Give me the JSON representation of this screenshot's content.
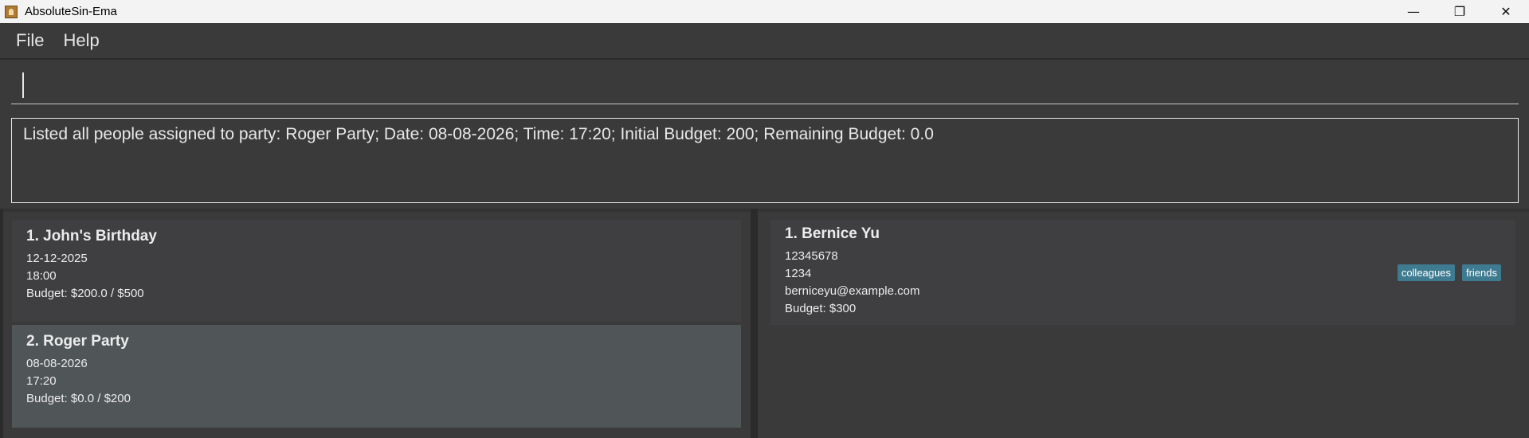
{
  "window": {
    "title": "AbsoluteSin-Ema",
    "controls": {
      "minimize": "—",
      "restore": "❐",
      "close": "✕"
    }
  },
  "menu": {
    "items": [
      "File",
      "Help"
    ]
  },
  "command": {
    "value": ""
  },
  "result": {
    "text": "Listed all people assigned to party: Roger Party; Date: 08-08-2026; Time: 17:20; Initial Budget: 200; Remaining Budget: 0.0"
  },
  "parties": [
    {
      "title": "1. John's Birthday",
      "date": "12-12-2025",
      "time": "18:00",
      "budget": "Budget: $200.0 / $500",
      "selected": false
    },
    {
      "title": "2. Roger Party",
      "date": "08-08-2026",
      "time": "17:20",
      "budget": "Budget: $0.0 / $200",
      "selected": true
    }
  ],
  "persons": [
    {
      "title": "1. Bernice Yu",
      "phone": "12345678",
      "address": "1234",
      "email": "berniceyu@example.com",
      "budget": "Budget: $300",
      "tags": [
        "colleagues",
        "friends"
      ]
    }
  ],
  "colors": {
    "background": "#3a3a3b",
    "card": "#3f3f42",
    "card_selected": "#505558",
    "tag": "#3e7b91"
  },
  "icons": {
    "app": "app-icon"
  }
}
